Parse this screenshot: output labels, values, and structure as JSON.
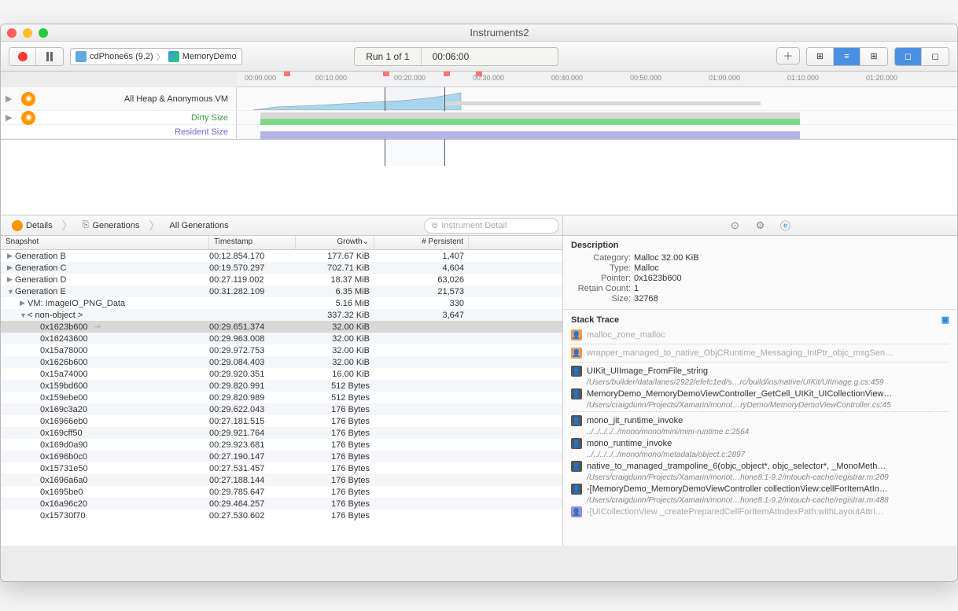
{
  "window_title": "Instruments2",
  "crumbs": {
    "device": "cdPhone6s (9.2)",
    "target": "MemoryDemo"
  },
  "run_status": {
    "label": "Run 1 of 1",
    "time": "00:06:00"
  },
  "timeline_ticks": [
    "00:00.000",
    "00:10.000",
    "00:20.000",
    "00:30.000",
    "00:40.000",
    "00:50.000",
    "01:00.000",
    "01:10.000",
    "01:20.000"
  ],
  "tracks": {
    "heap": "All Heap & Anonymous VM",
    "dirty": "Dirty Size",
    "resident": "Resident Size"
  },
  "breadcrumb": {
    "details": "Details",
    "generations": "Generations",
    "all": "All Generations"
  },
  "search_placeholder": "Instrument Detail",
  "columns": {
    "c1": "Snapshot",
    "c2": "Timestamp",
    "c3": "Growth⌄",
    "c4": "# Persistent"
  },
  "rows": [
    {
      "indent": 0,
      "tri": "▶",
      "name": "Generation B",
      "ts": "00:12.854.170",
      "growth": "177.67 KiB",
      "persist": "1,407"
    },
    {
      "indent": 0,
      "tri": "▶",
      "name": "Generation C",
      "ts": "00:19.570.297",
      "growth": "702.71 KiB",
      "persist": "4,604"
    },
    {
      "indent": 0,
      "tri": "▶",
      "name": "Generation D",
      "ts": "00:27.119.002",
      "growth": "18.37 MiB",
      "persist": "63,026"
    },
    {
      "indent": 0,
      "tri": "▼",
      "name": "Generation E",
      "ts": "00:31.282.109",
      "growth": "6.35 MiB",
      "persist": "21,573"
    },
    {
      "indent": 1,
      "tri": "▶",
      "name": "VM: ImageIO_PNG_Data",
      "ts": "",
      "growth": "5.16 MiB",
      "persist": "330"
    },
    {
      "indent": 1,
      "tri": "▼",
      "name": "< non-object >",
      "ts": "",
      "growth": "337.32 KiB",
      "persist": "3,647"
    },
    {
      "indent": 2,
      "tri": "",
      "name": "0x1623b600",
      "ts": "00:29.651.374",
      "growth": "32.00 KiB",
      "persist": "",
      "sel": true
    },
    {
      "indent": 2,
      "tri": "",
      "name": "0x16243600",
      "ts": "00:29.963.008",
      "growth": "32.00 KiB",
      "persist": ""
    },
    {
      "indent": 2,
      "tri": "",
      "name": "0x15a78000",
      "ts": "00:29.972.753",
      "growth": "32.00 KiB",
      "persist": ""
    },
    {
      "indent": 2,
      "tri": "",
      "name": "0x1626b600",
      "ts": "00:29.084.403",
      "growth": "32.00 KiB",
      "persist": ""
    },
    {
      "indent": 2,
      "tri": "",
      "name": "0x15a74000",
      "ts": "00:29.920.351",
      "growth": "16.00 KiB",
      "persist": ""
    },
    {
      "indent": 2,
      "tri": "",
      "name": "0x159bd600",
      "ts": "00:29.820.991",
      "growth": "512 Bytes",
      "persist": ""
    },
    {
      "indent": 2,
      "tri": "",
      "name": "0x159ebe00",
      "ts": "00:29.820.989",
      "growth": "512 Bytes",
      "persist": ""
    },
    {
      "indent": 2,
      "tri": "",
      "name": "0x169c3a20",
      "ts": "00:29.622.043",
      "growth": "176 Bytes",
      "persist": ""
    },
    {
      "indent": 2,
      "tri": "",
      "name": "0x16966eb0",
      "ts": "00:27.181.515",
      "growth": "176 Bytes",
      "persist": ""
    },
    {
      "indent": 2,
      "tri": "",
      "name": "0x169cff50",
      "ts": "00:29.921.764",
      "growth": "176 Bytes",
      "persist": ""
    },
    {
      "indent": 2,
      "tri": "",
      "name": "0x169d0a90",
      "ts": "00:29.923.681",
      "growth": "176 Bytes",
      "persist": ""
    },
    {
      "indent": 2,
      "tri": "",
      "name": "0x1696b0c0",
      "ts": "00:27.190.147",
      "growth": "176 Bytes",
      "persist": ""
    },
    {
      "indent": 2,
      "tri": "",
      "name": "0x15731e50",
      "ts": "00:27.531.457",
      "growth": "176 Bytes",
      "persist": ""
    },
    {
      "indent": 2,
      "tri": "",
      "name": "0x1696a6a0",
      "ts": "00:27.188.144",
      "growth": "176 Bytes",
      "persist": ""
    },
    {
      "indent": 2,
      "tri": "",
      "name": "0x1695be0",
      "ts": "00:29.785.647",
      "growth": "176 Bytes",
      "persist": ""
    },
    {
      "indent": 2,
      "tri": "",
      "name": "0x16a96c20",
      "ts": "00:29.464.257",
      "growth": "176 Bytes",
      "persist": ""
    },
    {
      "indent": 2,
      "tri": "",
      "name": "0x15730f70",
      "ts": "00:27.530.602",
      "growth": "176 Bytes",
      "persist": ""
    }
  ],
  "description": {
    "title": "Description",
    "category_l": "Category:",
    "category_v": "Malloc 32.00 KiB",
    "type_l": "Type:",
    "type_v": "Malloc",
    "pointer_l": "Pointer:",
    "pointer_v": "0x1623b600",
    "retain_l": "Retain Count:",
    "retain_v": "1",
    "size_l": "Size:",
    "size_v": "32768"
  },
  "stack": {
    "title": "Stack Trace",
    "items": [
      {
        "icon": "or",
        "fn": "malloc_zone_malloc",
        "dim": true
      },
      {
        "dotted": true
      },
      {
        "icon": "or",
        "fn": "wrapper_managed_to_native_ObjCRuntime_Messaging_IntPtr_objc_msgSen…",
        "dim": true
      },
      {
        "dotted": true
      },
      {
        "icon": "bk",
        "fn": "UIKit_UIImage_FromFile_string",
        "sub": "/Users/builder/data/lanes/2922/efefc1ed/s…rc/build/ios/native/UIKit/UIImage.g.cs:459"
      },
      {
        "icon": "bk",
        "fn": "MemoryDemo_MemoryDemoViewController_GetCell_UIKit_UICollectionView…",
        "sub": "/Users/craigdunn/Projects/Xamarin/monot…ryDemo/MemoryDemoViewController.cs:45"
      },
      {
        "dotted": true
      },
      {
        "icon": "bk",
        "fn": "mono_jit_runtime_invoke",
        "sub": "../../../../../mono/mono/mini/mini-runtime.c:2564"
      },
      {
        "icon": "bk",
        "fn": "mono_runtime_invoke",
        "sub": "../../../../../mono/mono/metadata/object.c:2897"
      },
      {
        "icon": "bk",
        "fn": "native_to_managed_trampoline_6(objc_object*, objc_selector*, _MonoMeth…",
        "sub": "/Users/craigdunn/Projects/Xamarin/monot…hone8.1-9.2/mtouch-cache/registrar.m:209"
      },
      {
        "icon": "bk",
        "fn": "-[MemoryDemo_MemoryDemoViewController collectionView:cellForItemAtIn…",
        "sub": "/Users/craigdunn/Projects/Xamarin/monot…hone8.1-9.2/mtouch-cache/registrar.m:488"
      },
      {
        "icon": "pu",
        "fn": "-[UICollectionView _createPreparedCellForItemAtIndexPath:withLayoutAttri…",
        "dim": true
      }
    ]
  }
}
